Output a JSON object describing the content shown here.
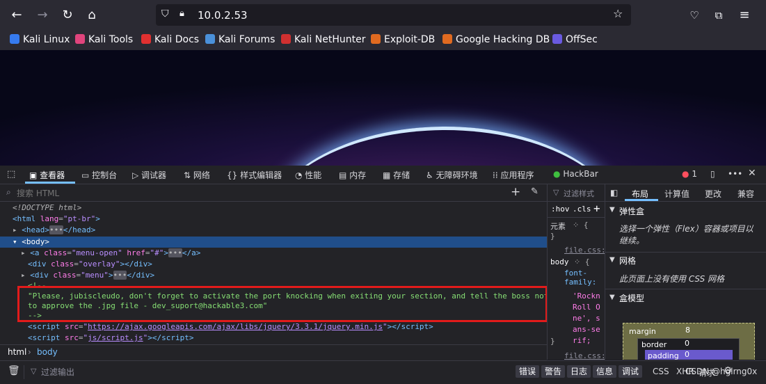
{
  "browser": {
    "url": "10.0.2.53",
    "bookmarks": [
      "Kali Linux",
      "Kali Tools",
      "Kali Docs",
      "Kali Forums",
      "Kali NetHunter",
      "Exploit-DB",
      "Google Hacking DB",
      "OffSec"
    ]
  },
  "devtools": {
    "tabs": [
      "查看器",
      "控制台",
      "调试器",
      "网络",
      "样式编辑器",
      "性能",
      "内存",
      "存储",
      "无障碍环境",
      "应用程序",
      "HackBar"
    ],
    "error_count": "1",
    "search_placeholder": "搜索 HTML",
    "markup": {
      "doctype": "<!DOCTYPE html>",
      "html_lang": "pt-br",
      "head": "head",
      "body": "body",
      "a_class": "menu-open",
      "a_href": "#",
      "overlay_class": "overlay",
      "menu_class": "menu",
      "comment_open": "<!--",
      "comment_line1": "\"Please, jubiscleudo, don't forget to activate the port knocking when exiting your section, and tell the boss not to forget",
      "comment_line2": "to approve the .jpg file - dev_suport@hackable3.com\"",
      "comment_close": "-->",
      "script1_src": "https://ajax.googleapis.com/ajax/libs/jquery/3.3.1/jquery.min.js",
      "script2_src": "js/script.js"
    },
    "breadcrumbs": [
      "html",
      "body"
    ],
    "rules": {
      "filter_placeholder": "过滤样式",
      "hov": ":hov",
      "cls": ".cls",
      "element": "元素",
      "file": "file.css:",
      "selector": "body",
      "prop": "font-family:",
      "value": "'RocknRoll One', sans-serif;"
    },
    "layout": {
      "tabs": [
        "布局",
        "计算值",
        "更改",
        "兼容"
      ],
      "flex_title": "弹性盒",
      "flex_text": "选择一个弹性（Flex）容器或项目以继续。",
      "grid_title": "网格",
      "grid_text": "此页面上没有使用 CSS 网格",
      "box_title": "盒模型",
      "margin": "margin",
      "margin_val": "8",
      "border": "border",
      "border_val": "0",
      "padding": "padding",
      "padding_val": "0"
    },
    "console": {
      "filter_placeholder": "过滤输出",
      "levels": [
        "错误",
        "警告",
        "日志",
        "信息",
        "调试"
      ],
      "extra": [
        "CSS",
        "XHR",
        "请求"
      ],
      "watermark": "CSDN @hglrng0x"
    }
  }
}
